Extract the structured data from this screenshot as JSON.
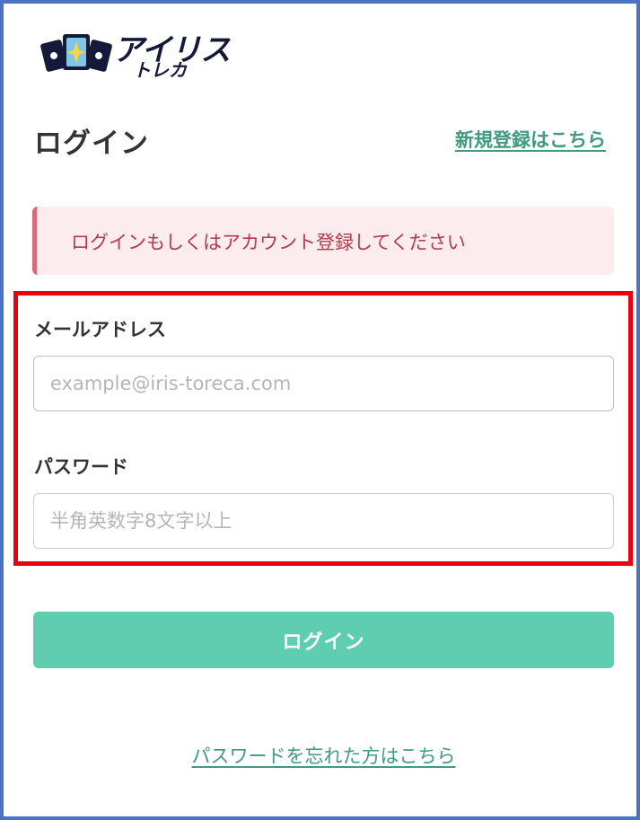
{
  "brand": {
    "logo_text": "アイリス",
    "logo_subtext": "トレカ",
    "colors": {
      "navy": "#151a3a",
      "accent": "#5ecdb0",
      "link": "#3f9a80"
    }
  },
  "header": {
    "title": "ログイン",
    "register_link": "新規登録はこちら"
  },
  "alert": {
    "message": "ログインもしくはアカウント登録してください",
    "colors": {
      "background": "#fcecee",
      "border": "#d86a78",
      "text": "#b43a4d"
    }
  },
  "form": {
    "email": {
      "label": "メールアドレス",
      "value": "",
      "placeholder": "example@iris-toreca.com"
    },
    "password": {
      "label": "パスワード",
      "value": "",
      "placeholder": "半角英数字8文字以上"
    },
    "highlight_color": "#e8000b"
  },
  "actions": {
    "login_button": "ログイン",
    "forgot_password_link": "パスワードを忘れた方はこちら"
  }
}
